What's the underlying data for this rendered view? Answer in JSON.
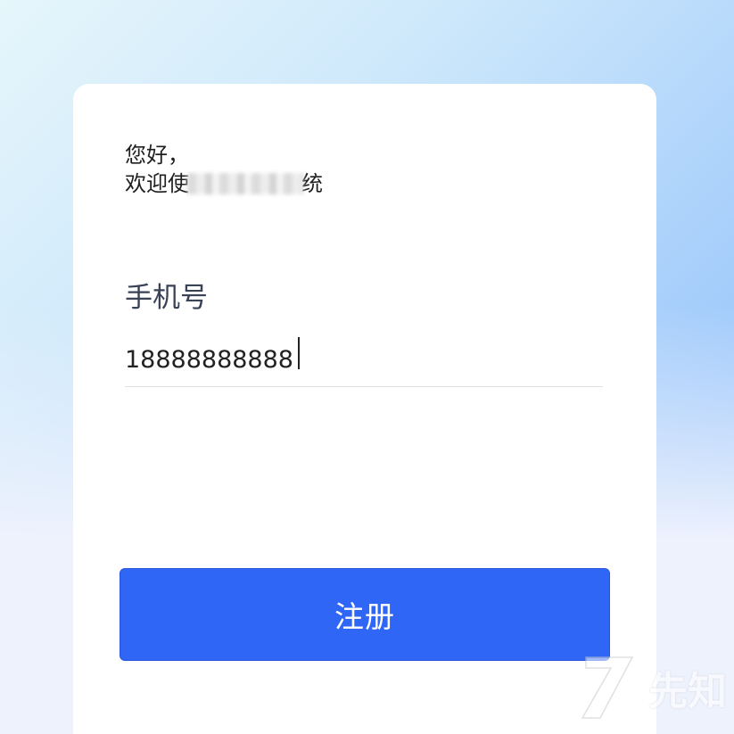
{
  "greeting": {
    "line1": "您好，",
    "line2_prefix": "欢迎使",
    "line2_suffix": "统"
  },
  "phone_field": {
    "label": "手机号",
    "value": "18888888888"
  },
  "register_button": {
    "label": "注册"
  },
  "watermark": {
    "text": "先知"
  },
  "colors": {
    "primary": "#2f66f6",
    "label_text": "#3a4256",
    "card_background": "#ffffff"
  }
}
